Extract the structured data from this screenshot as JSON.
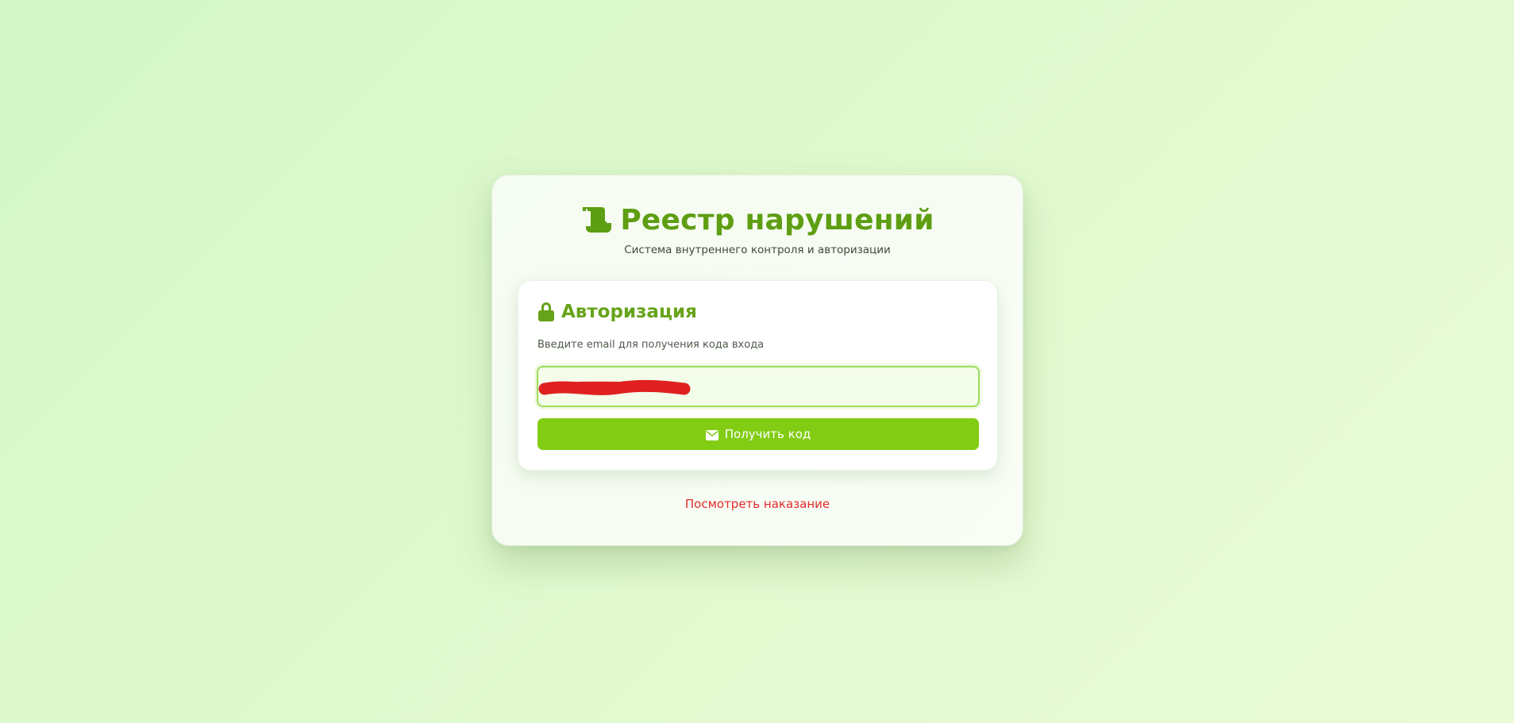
{
  "app": {
    "title": "Реестр нарушений",
    "subtitle": "Система внутреннего контроля и авторизации",
    "logo_icon": "scroll-icon",
    "accent_color": "#5e9e12"
  },
  "auth": {
    "heading": "Авторизация",
    "heading_icon": "lock-icon",
    "hint": "Введите email для получения кода входа",
    "email_value": "",
    "email_redacted": true,
    "submit_label": "Получить код",
    "submit_icon": "envelope-icon",
    "button_color": "#82cc14"
  },
  "footer": {
    "link_label": "Посмотреть наказание",
    "link_color": "#e52b2b"
  }
}
